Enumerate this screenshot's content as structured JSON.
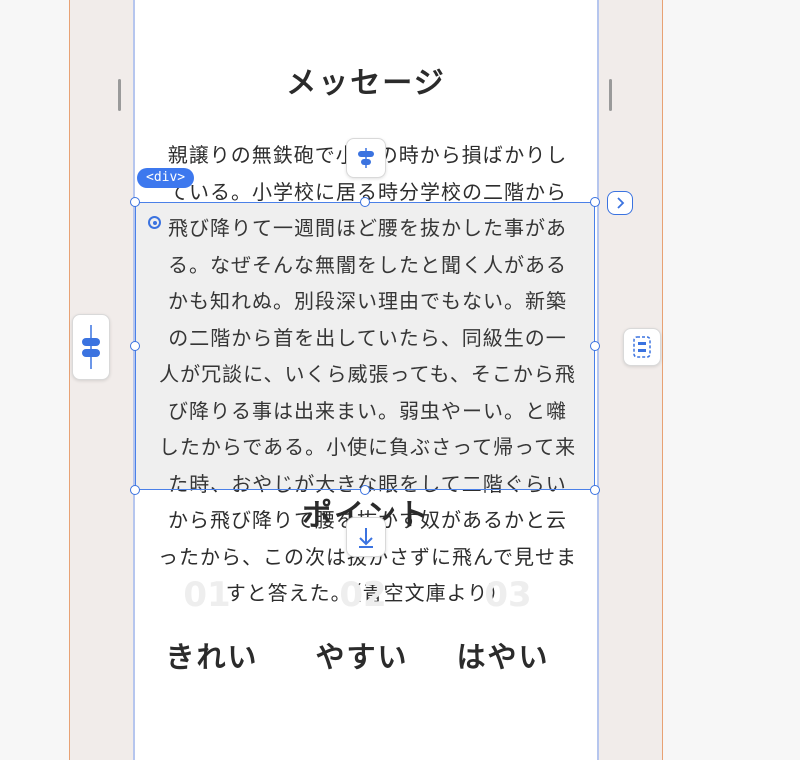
{
  "page": {
    "heading": "メッセージ",
    "body_lines": [
      "親譲りの無鉄砲で小供の時から損ばかりし",
      "ている。小学校に居る時分学校の二階から",
      "飛び降りて一週間ほど腰を抜かした事があ",
      "る。なぜそんな無闇をしたと聞く人がある",
      "かも知れぬ。別段深い理由でもない。新築",
      "の二階から首を出していたら、同級生の一",
      "人が冗談に、いくら威張っても、そこから飛",
      "び降りる事は出来まい。弱虫やーい。と囃",
      "したからである。小使に負ぶさって帰って来",
      "た時、おやじが大きな眼をして二階ぐらい",
      "から飛び降りて腰を抜かす奴があるかと云",
      "ったから、この次は抜かさずに飛んで見せま",
      "すと答えた。（青空文庫より）"
    ],
    "sub_heading": "ポイント",
    "points": [
      {
        "num": "01",
        "label": "きれい"
      },
      {
        "num": "02",
        "label": "やすい"
      },
      {
        "num": "03",
        "label": "はやい"
      }
    ]
  },
  "editor": {
    "selected_tag": "<div>",
    "icons": {
      "padding_top": "padding-top-icon",
      "padding_bottom": "padding-bottom-icon",
      "padding_left": "padding-left-icon",
      "layout": "layout-icon",
      "next": "chevron-right-icon",
      "target": "target-icon"
    },
    "colors": {
      "accent": "#3d78ee",
      "guide": "#e8a274",
      "selection_fill": "rgba(120,120,120,0.12)"
    }
  }
}
